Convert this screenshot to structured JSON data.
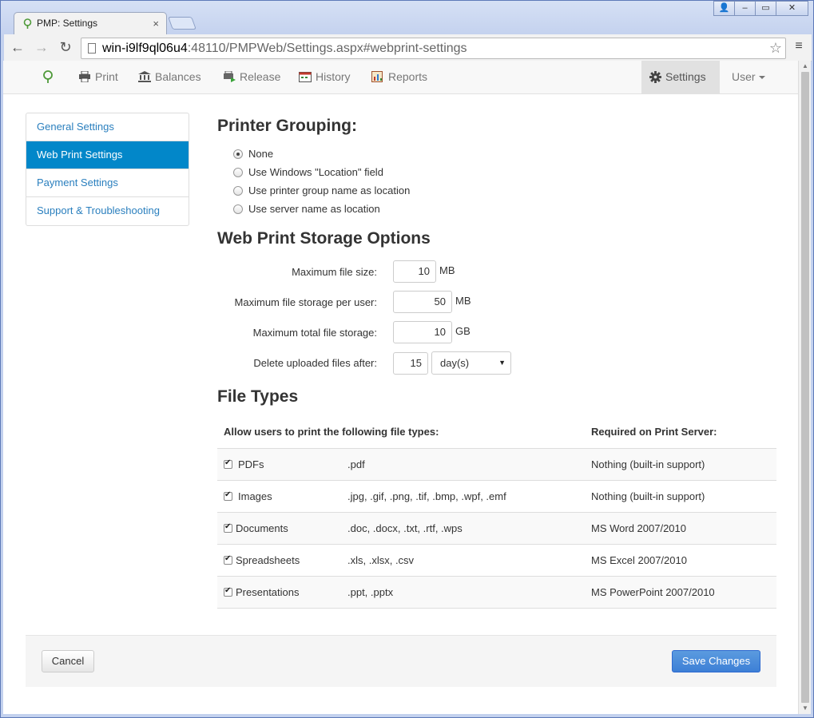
{
  "browser": {
    "tab_title": "PMP: Settings",
    "tab_close": "×",
    "url_host": "win-i9lf9ql06u4",
    "url_rest": ":48110/PMPWeb/Settings.aspx#webprint-settings",
    "back": "←",
    "forward": "→",
    "reload": "↻",
    "star": "☆",
    "menu": "≡",
    "window_buttons": [
      "👤",
      "–",
      "▭",
      "✕"
    ]
  },
  "app_nav": {
    "items": [
      {
        "label": "Print",
        "icon": "printer-icon"
      },
      {
        "label": "Balances",
        "icon": "bank-icon"
      },
      {
        "label": "Release",
        "icon": "release-icon"
      },
      {
        "label": "History",
        "icon": "calendar-icon"
      },
      {
        "label": "Reports",
        "icon": "reports-icon"
      }
    ],
    "settings_label": "Settings",
    "user_label": "User"
  },
  "sidebar": {
    "items": [
      {
        "label": "General Settings"
      },
      {
        "label": "Web Print Settings",
        "active": true
      },
      {
        "label": "Payment Settings"
      },
      {
        "label": "Support & Troubleshooting"
      }
    ]
  },
  "printer_grouping": {
    "title": "Printer Grouping:",
    "options": [
      {
        "label": "None",
        "selected": true
      },
      {
        "label": "Use Windows \"Location\" field"
      },
      {
        "label": "Use printer group name as location"
      },
      {
        "label": "Use server name as location"
      }
    ]
  },
  "storage": {
    "title": "Web Print Storage Options",
    "max_file_size": {
      "label": "Maximum file size:",
      "value": "10",
      "unit": "MB"
    },
    "max_per_user": {
      "label": "Maximum file storage per user:",
      "value": "50",
      "unit": "MB"
    },
    "max_total": {
      "label": "Maximum total file storage:",
      "value": "10",
      "unit": "GB"
    },
    "delete_after": {
      "label": "Delete uploaded files after:",
      "value": "15",
      "unit_selected": "day(s)"
    }
  },
  "file_types": {
    "title": "File Types",
    "header_allow": "Allow users to print the following file types:",
    "header_required": "Required on Print Server:",
    "rows": [
      {
        "name": "PDFs",
        "extensions": ".pdf",
        "required": "Nothing (built-in support)",
        "checked": true
      },
      {
        "name": "Images",
        "extensions": ".jpg, .gif, .png, .tif, .bmp, .wpf, .emf",
        "required": "Nothing (built-in support)",
        "checked": true
      },
      {
        "name": "Documents",
        "extensions": ".doc, .docx, .txt, .rtf, .wps",
        "required": "MS Word 2007/2010",
        "checked": true
      },
      {
        "name": "Spreadsheets",
        "extensions": ".xls, .xlsx, .csv",
        "required": "MS Excel 2007/2010",
        "checked": true
      },
      {
        "name": "Presentations",
        "extensions": ".ppt, .pptx",
        "required": "MS PowerPoint 2007/2010",
        "checked": true
      }
    ]
  },
  "footer": {
    "cancel_label": "Cancel",
    "save_label": "Save Changes"
  },
  "colors": {
    "accent": "#0287c9",
    "save_button": "#428bca",
    "link": "#2a7fbe"
  }
}
